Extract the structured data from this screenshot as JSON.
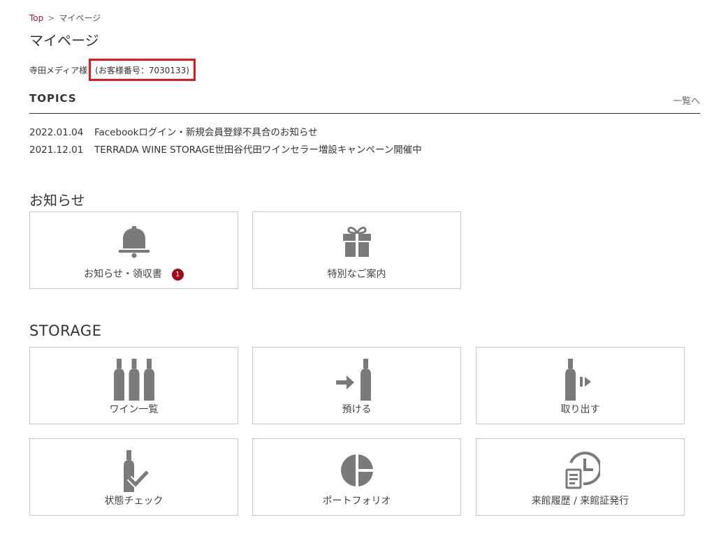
{
  "breadcrumb": {
    "home": "Top",
    "separator": ">",
    "current": "マイページ"
  },
  "page_title": "マイページ",
  "customer": {
    "name": "寺田メディア様",
    "number": "(お客様番号：7030133)"
  },
  "topics": {
    "title": "TOPICS",
    "more": "一覧へ",
    "items": [
      {
        "date": "2022.01.04",
        "text": "Facebookログイン・新規会員登録不具合のお知らせ"
      },
      {
        "date": "2021.12.01",
        "text": "TERRADA WINE STORAGE世田谷代田ワインセラー増設キャンペーン開催中"
      }
    ]
  },
  "notice": {
    "title": "お知らせ",
    "cards": [
      {
        "label": "お知らせ・領収書",
        "badge": "1",
        "icon": "bell-icon"
      },
      {
        "label": "特別なご案内",
        "icon": "gift-icon"
      }
    ]
  },
  "storage": {
    "title": "STORAGE",
    "cards": [
      {
        "label": "ワイン一覧",
        "icon": "wine-bottles-icon"
      },
      {
        "label": "預ける",
        "icon": "deposit-bottle-icon"
      },
      {
        "label": "取り出す",
        "icon": "withdraw-bottle-icon"
      },
      {
        "label": "状態チェック",
        "icon": "bottle-check-icon"
      },
      {
        "label": "ポートフォリオ",
        "icon": "portfolio-chart-icon"
      },
      {
        "label": "来館履歴 / 来館証発行",
        "icon": "visit-history-icon"
      }
    ]
  },
  "colors": {
    "accent": "#a0182a",
    "highlight_border": "#e0191e",
    "badge": "#a00a14",
    "icon": "#7a7a7a"
  }
}
